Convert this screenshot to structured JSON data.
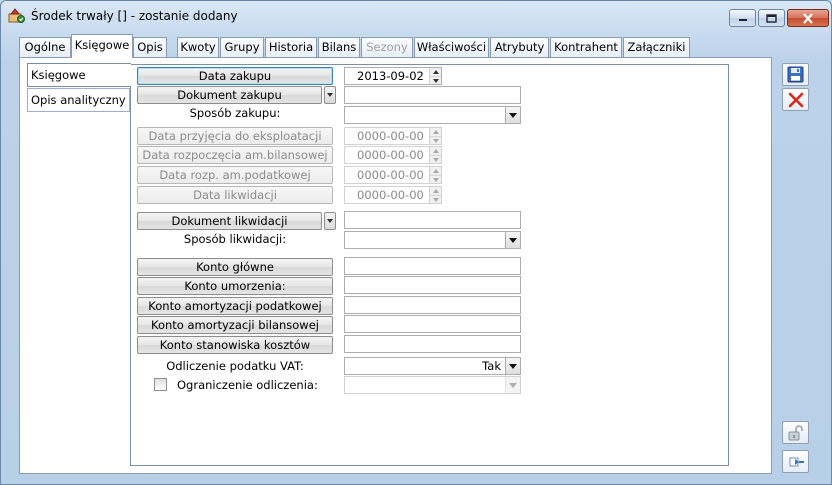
{
  "window": {
    "title": "Środek trwały [] - zostanie dodany",
    "controls": [
      "minimize-icon",
      "maximize-icon",
      "close-icon"
    ]
  },
  "tabs": [
    {
      "label": "Ogólne",
      "state": "normal"
    },
    {
      "label": "Księgowe",
      "state": "active"
    },
    {
      "label": "Opis",
      "state": "normal"
    },
    {
      "label": "Kwoty",
      "state": "normal"
    },
    {
      "label": "Grupy",
      "state": "normal"
    },
    {
      "label": "Historia",
      "state": "normal"
    },
    {
      "label": "Bilans",
      "state": "normal"
    },
    {
      "label": "Sezony",
      "state": "disabled"
    },
    {
      "label": "Właściwości",
      "state": "normal"
    },
    {
      "label": "Atrybuty",
      "state": "normal"
    },
    {
      "label": "Kontrahent",
      "state": "normal"
    },
    {
      "label": "Załączniki",
      "state": "normal"
    }
  ],
  "subtabs": [
    {
      "label": "Księgowe",
      "state": "active"
    },
    {
      "label": "Opis analityczny",
      "state": "normal"
    }
  ],
  "form": {
    "data_zakupu": {
      "label": "Data zakupu",
      "value": "2013-09-02"
    },
    "dokument_zakupu": {
      "label": "Dokument zakupu",
      "value": ""
    },
    "sposob_zakupu": {
      "label": "Sposób zakupu:",
      "value": ""
    },
    "data_przyjecia": {
      "label": "Data przyjęcia do eksploatacji",
      "value": "0000-00-00"
    },
    "data_rozpoczecia_bil": {
      "label": "Data rozpoczęcia am.bilansowej",
      "value": "0000-00-00"
    },
    "data_rozp_pod": {
      "label": "Data rozp. am.podatkowej",
      "value": "0000-00-00"
    },
    "data_likwidacji": {
      "label": "Data likwidacji",
      "value": "0000-00-00"
    },
    "dokument_likwidacji": {
      "label": "Dokument likwidacji",
      "value": ""
    },
    "sposob_likwidacji": {
      "label": "Sposób likwidacji:",
      "value": ""
    },
    "konto_glowne": {
      "label": "Konto główne",
      "value": ""
    },
    "konto_umorzenia": {
      "label": "Konto umorzenia:",
      "value": ""
    },
    "konto_am_pod": {
      "label": "Konto amortyzacji podatkowej",
      "value": ""
    },
    "konto_am_bil": {
      "label": "Konto amortyzacji bilansowej",
      "value": ""
    },
    "konto_stanowiska": {
      "label": "Konto stanowiska kosztów",
      "value": ""
    },
    "odliczenie_vat": {
      "label": "Odliczenie podatku VAT:",
      "value": "Tak"
    },
    "ograniczenie": {
      "label": "Ograniczenie odliczenia:",
      "checked": false,
      "value": ""
    }
  },
  "side_buttons": [
    "save-icon",
    "delete-icon",
    "unlock-icon",
    "attach-icon"
  ],
  "colors": {
    "accent": "#3c7fb1",
    "delete": "#d9281a",
    "save": "#3a6fc4"
  }
}
